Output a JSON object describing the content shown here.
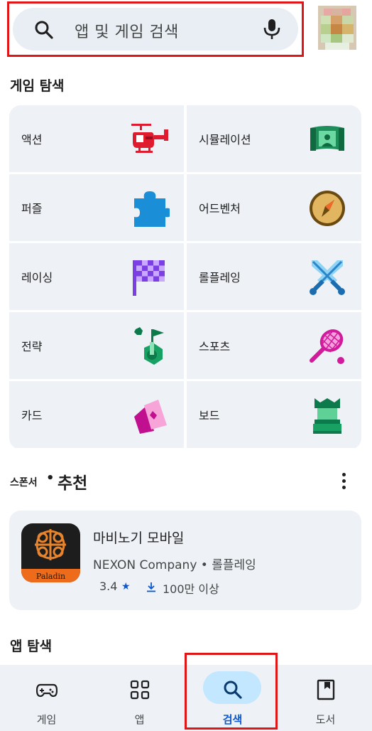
{
  "search": {
    "placeholder": "앱 및 게임 검색",
    "icon": "search-icon",
    "mic_icon": "microphone-icon"
  },
  "avatar": {
    "icon": "avatar"
  },
  "explore_games": {
    "title": "게임 탐색",
    "categories": [
      {
        "label": "액션",
        "icon": "helicopter-icon"
      },
      {
        "label": "시뮬레이션",
        "icon": "simulation-screen-icon"
      },
      {
        "label": "퍼즐",
        "icon": "puzzle-piece-icon"
      },
      {
        "label": "어드벤처",
        "icon": "compass-icon"
      },
      {
        "label": "레이싱",
        "icon": "checkered-flag-icon"
      },
      {
        "label": "롤플레잉",
        "icon": "crossed-swords-icon"
      },
      {
        "label": "전략",
        "icon": "strategy-flag-icon"
      },
      {
        "label": "스포츠",
        "icon": "tennis-racket-icon"
      },
      {
        "label": "카드",
        "icon": "cards-icon"
      },
      {
        "label": "보드",
        "icon": "chess-rook-icon"
      }
    ]
  },
  "sponsored": {
    "small_label": "스폰서",
    "dot": "•",
    "big_label": "추천",
    "more_icon": "more-vertical-icon",
    "app": {
      "name": "마비노기 모바일",
      "developer_line": "NEXON Company • 롤플레잉",
      "rating": "3.4",
      "star": "★",
      "downloads": "100만 이상",
      "icon_band_text": "Paladin"
    }
  },
  "explore_apps": {
    "title": "앱 탐색"
  },
  "bottom_nav": {
    "items": [
      {
        "label": "게임",
        "icon": "gamepad-icon",
        "active": false
      },
      {
        "label": "앱",
        "icon": "apps-grid-icon",
        "active": false
      },
      {
        "label": "검색",
        "icon": "search-icon",
        "active": true
      },
      {
        "label": "도서",
        "icon": "book-icon",
        "active": false
      }
    ]
  },
  "colors": {
    "accent": "#0b57d0",
    "active_pill": "#c2e7ff",
    "surface": "#eef2f7",
    "highlight_border": "#e01515"
  }
}
